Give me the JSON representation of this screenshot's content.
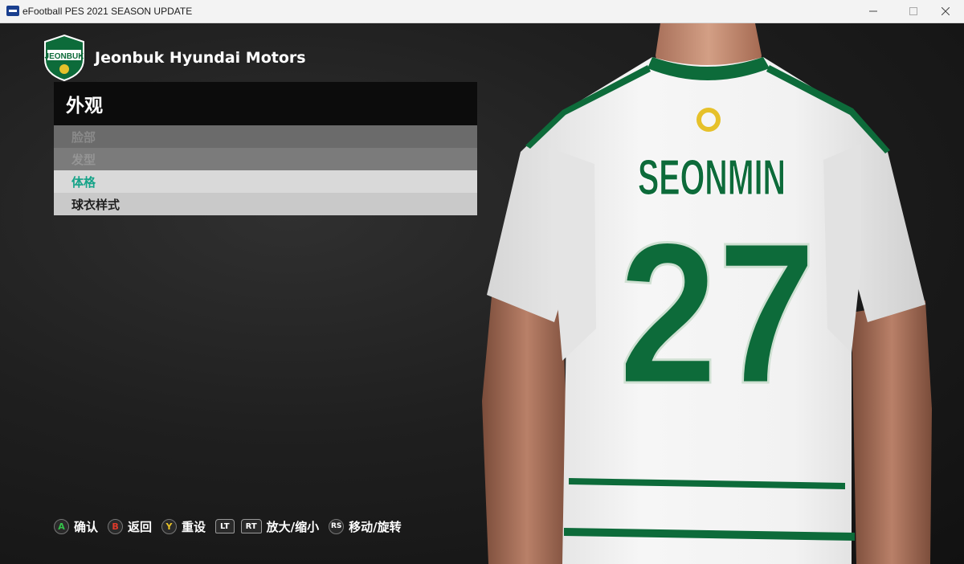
{
  "window": {
    "title": "eFootball PES 2021 SEASON UPDATE"
  },
  "club": {
    "name": "Jeonbuk Hyundai Motors",
    "logo_text": "JEONBUK"
  },
  "menu": {
    "title": "外观",
    "selected_index": 2,
    "items": [
      {
        "label": "脸部"
      },
      {
        "label": "发型"
      },
      {
        "label": "体格"
      },
      {
        "label": "球衣样式"
      }
    ]
  },
  "player": {
    "name": "SEONMIN",
    "number": "27"
  },
  "controls": [
    {
      "key": "A",
      "label": "确认"
    },
    {
      "key": "B",
      "label": "返回"
    },
    {
      "key": "Y",
      "label": "重设"
    },
    {
      "key": "LT",
      "label": ""
    },
    {
      "key": "RT",
      "label": "放大/缩小"
    },
    {
      "key": "RS",
      "label": "移动/旋转"
    }
  ],
  "colors": {
    "accent": "#15a388",
    "jersey_green": "#0d6b3a",
    "button_a": "#34c24a",
    "button_b": "#e23a2a",
    "button_y": "#e8c227"
  },
  "icons": {
    "app": "efootball-app-icon",
    "minimize": "minimize-icon",
    "maximize": "maximize-icon",
    "close": "close-icon"
  }
}
